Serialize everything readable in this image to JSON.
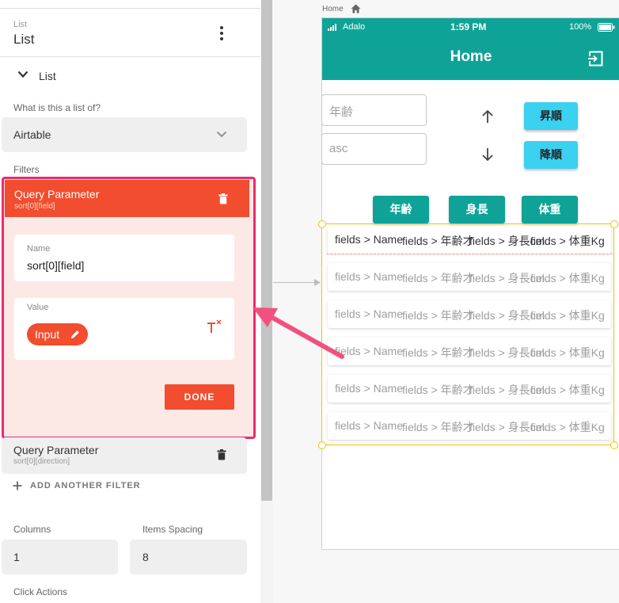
{
  "panel": {
    "header_small": "List",
    "header_title": "List",
    "section_title": "List",
    "what_label": "What is this a list of?",
    "source_value": "Airtable",
    "filters_label": "Filters",
    "filter1": {
      "title": "Query Parameter",
      "subtitle": "sort[0][field]",
      "name_label": "Name",
      "name_value": "sort[0][field]",
      "value_label": "Value",
      "value_pill": "Input",
      "done_label": "DONE"
    },
    "filter2": {
      "title": "Query Parameter",
      "subtitle": "sort[0][direction]"
    },
    "add_filter_label": "ADD ANOTHER FILTER",
    "columns_label": "Columns",
    "columns_value": "1",
    "spacing_label": "Items Spacing",
    "spacing_value": "8",
    "click_actions_label": "Click Actions"
  },
  "canvas": {
    "screen_label": "Home",
    "status": {
      "carrier": "Adalo",
      "time": "1:59 PM",
      "battery": "100%"
    },
    "app_title": "Home",
    "inputs": {
      "field1_placeholder": "年齢",
      "field2_placeholder": "asc"
    },
    "buttons": {
      "asc": "昇順",
      "desc": "降順",
      "age": "年齢",
      "height": "身長",
      "weight": "体重"
    },
    "rows": [
      {
        "c1": "fields > Name",
        "c2": "fields > 年齢才",
        "c3": "fields > 身長cm",
        "c4": "fields > 体重Kg"
      },
      {
        "c1": "fields > Name",
        "c2": "fields > 年齢才",
        "c3": "fields > 身長cm",
        "c4": "fields > 体重Kg"
      },
      {
        "c1": "fields > Name",
        "c2": "fields > 年齢才",
        "c3": "fields > 身長cm",
        "c4": "fields > 体重Kg"
      },
      {
        "c1": "fields > Name",
        "c2": "fields > 年齢才",
        "c3": "fields > 身長cm",
        "c4": "fields > 体重Kg"
      },
      {
        "c1": "fields > Name",
        "c2": "fields > 年齢才",
        "c3": "fields > 身長cm",
        "c4": "fields > 体重Kg"
      },
      {
        "c1": "fields > Name",
        "c2": "fields > 年齢才",
        "c3": "fields > 身長cm",
        "c4": "fields > 体重Kg"
      }
    ]
  },
  "colors": {
    "accent": "#f14d2e",
    "teal": "#0fa398",
    "cyan": "#3bd1f0",
    "highlight": "#ee2a6e",
    "selection": "#f2c200"
  },
  "icons": [
    "more-vert-icon",
    "chevron-down-icon",
    "trash-icon",
    "pencil-icon",
    "magic-text-icon",
    "plus-icon",
    "home-icon",
    "logout-icon",
    "arrow-up-icon",
    "arrow-down-icon",
    "wifi-icon",
    "battery-icon"
  ]
}
